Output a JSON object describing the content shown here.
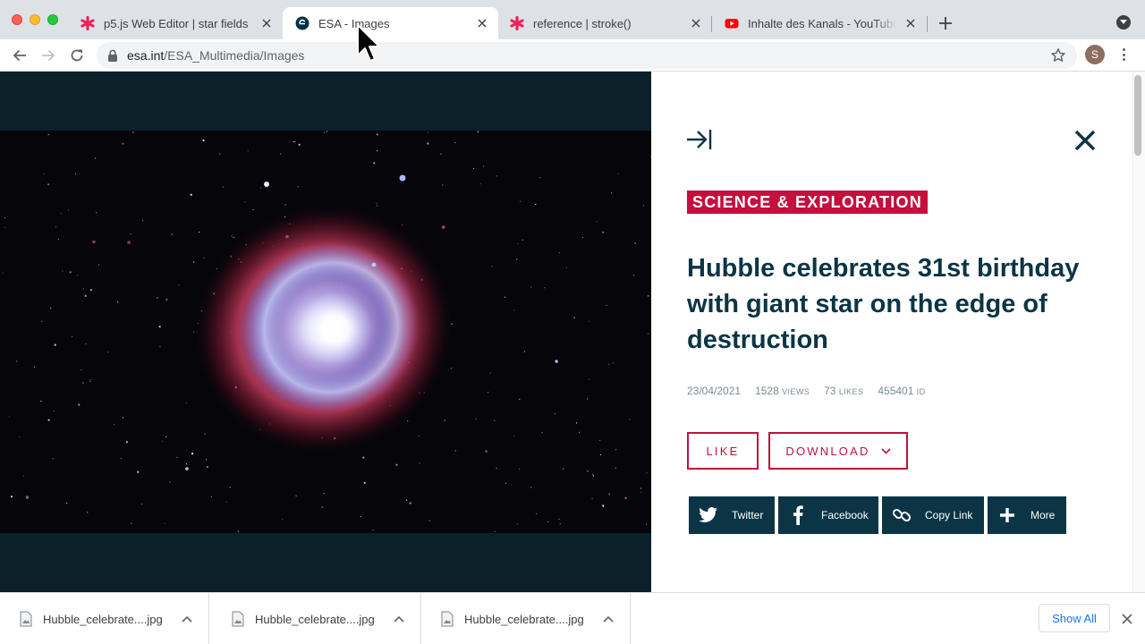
{
  "browser": {
    "tabs": [
      {
        "title": "p5.js Web Editor | star fields",
        "icon": "p5-asterisk-icon",
        "active": false
      },
      {
        "title": "ESA - Images",
        "icon": "esa-logo-icon",
        "active": true
      },
      {
        "title": "reference | stroke()",
        "icon": "p5-asterisk-icon",
        "active": false
      },
      {
        "title": "Inhalte des Kanals - YouTube Studio",
        "icon": "youtube-icon",
        "active": false
      }
    ],
    "url_domain": "esa.int",
    "url_path": "/ESA_Multimedia/Images",
    "profile_initial": "S"
  },
  "panel": {
    "category": "SCIENCE & EXPLORATION",
    "headline": "Hubble celebrates 31st birthday with giant star on the edge of destruction",
    "date": "23/04/2021",
    "views": "1528",
    "views_unit": "VIEWS",
    "likes": "73",
    "likes_unit": "LIKES",
    "id": "455401",
    "id_unit": "ID",
    "like_label": "LIKE",
    "download_label": "DOWNLOAD",
    "share": {
      "twitter": "Twitter",
      "facebook": "Facebook",
      "copy_link": "Copy Link",
      "more": "More"
    }
  },
  "downloads": {
    "items": [
      {
        "name": "Hubble_celebrate....jpg"
      },
      {
        "name": "Hubble_celebrate....jpg"
      },
      {
        "name": "Hubble_celebrate....jpg"
      }
    ],
    "show_all": "Show All"
  },
  "colors": {
    "accent": "#c3103d",
    "navy": "#0b3545",
    "viewer_bg": "#0b2129"
  }
}
